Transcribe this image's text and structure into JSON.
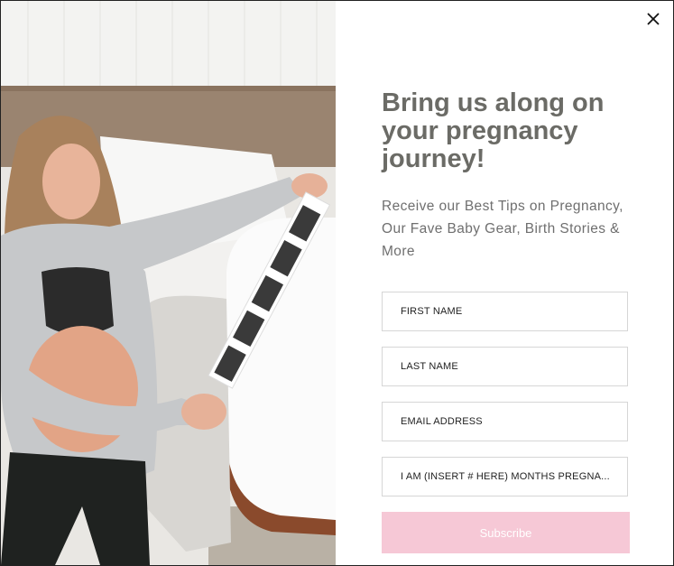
{
  "popup": {
    "headline": "Bring us along on your pregnancy journey!",
    "subtext": "Receive our Best Tips on Pregnancy, Our Fave Baby Gear, Birth Stories & More",
    "close_icon": "close-icon"
  },
  "form": {
    "first_name_placeholder": "FIRST NAME",
    "last_name_placeholder": "LAST NAME",
    "email_placeholder": "EMAIL ADDRESS",
    "months_placeholder": "I AM (INSERT # HERE) MONTHS PREGNA...",
    "subscribe_label": "Subscribe"
  },
  "colors": {
    "headline": "#6b6b66",
    "button": "#f6c8d6",
    "button_text": "#ffffff",
    "field_border": "#d6d6d6"
  }
}
